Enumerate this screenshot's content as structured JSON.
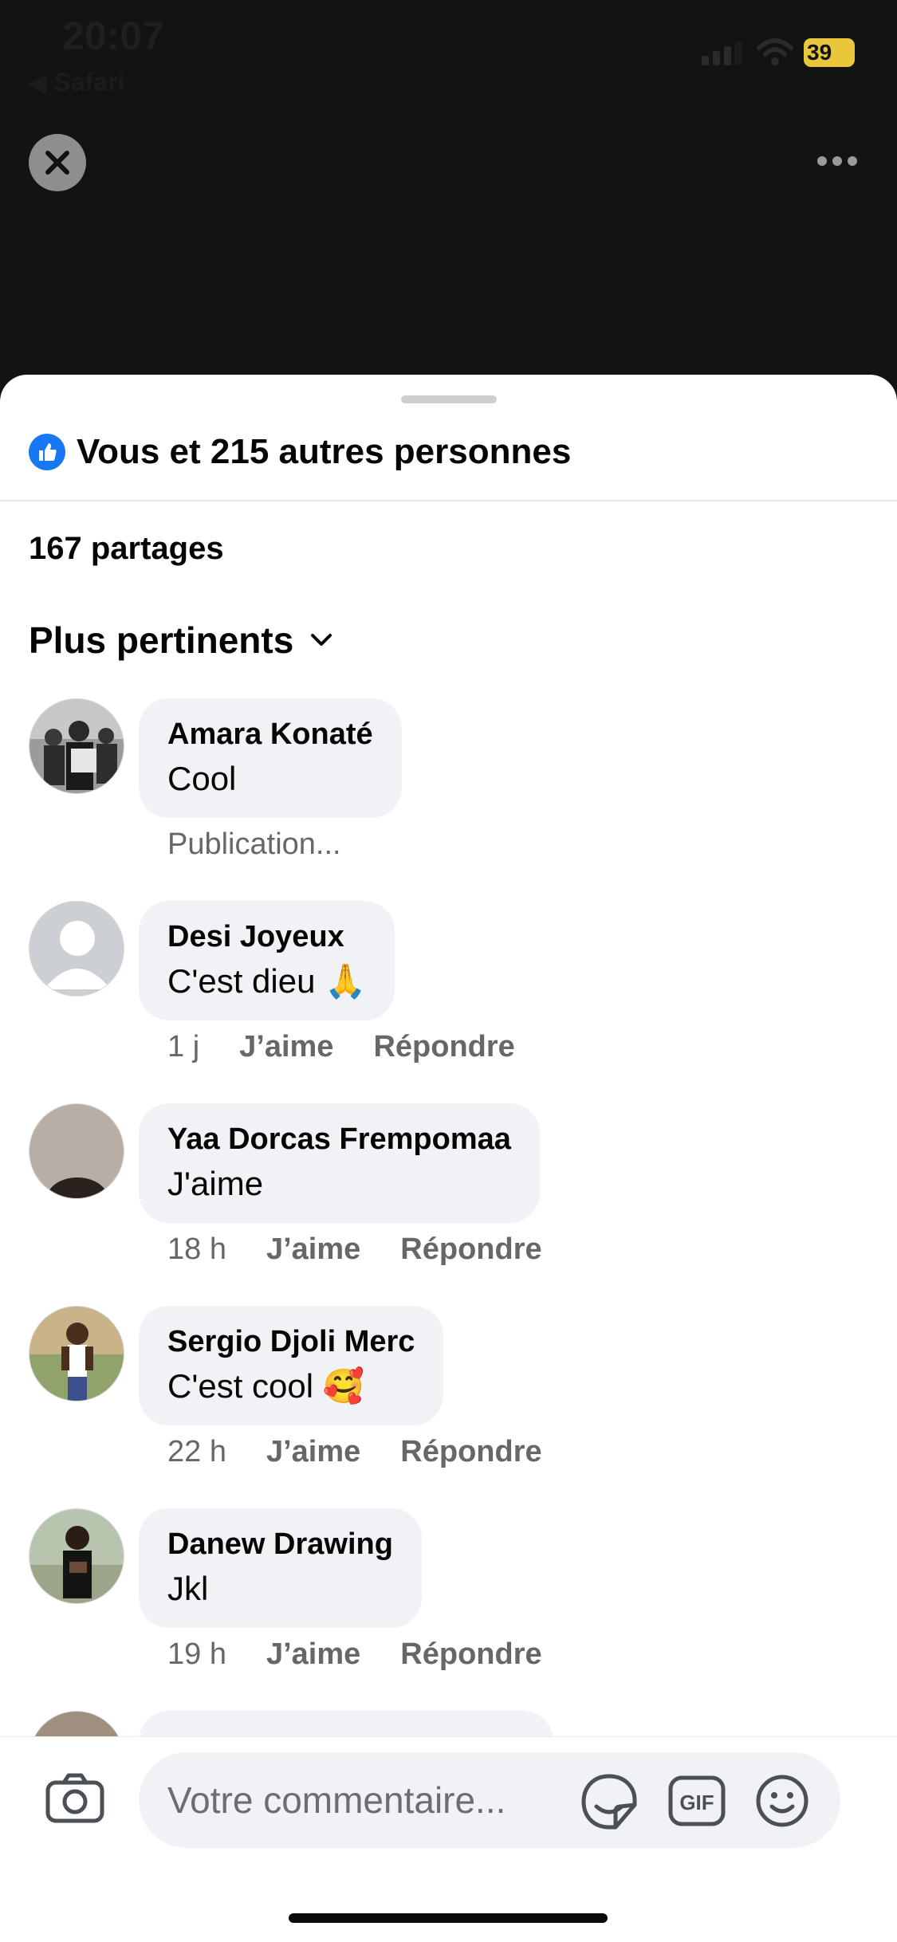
{
  "status_bar": {
    "time": "20:07",
    "back_app": "◀ Safari",
    "battery": "39"
  },
  "sheet": {
    "reactions_text": "Vous et 215 autres personnes",
    "shares_text": "167 partages",
    "sort_label": "Plus pertinents"
  },
  "comments": [
    {
      "author": "Amara Konaté",
      "text": "Cool",
      "status": "Publication..."
    },
    {
      "author": "Desi Joyeux",
      "text": "C'est dieu 🙏",
      "time": "1 j",
      "like": "J’aime",
      "reply": "Répondre"
    },
    {
      "author": "Yaa Dorcas Frempomaa",
      "text": "J'aime",
      "time": "18 h",
      "like": "J’aime",
      "reply": "Répondre"
    },
    {
      "author": "Sergio Djoli Merc",
      "text": "C'est cool 🥰",
      "time": "22 h",
      "like": "J’aime",
      "reply": "Répondre"
    },
    {
      "author": "Danew Drawing",
      "text": "Jkl",
      "time": "19 h",
      "like": "J’aime",
      "reply": "Répondre"
    }
  ],
  "composer": {
    "placeholder": "Votre commentaire...",
    "gif_label": "GIF"
  },
  "icons": {
    "close": "close-icon",
    "more": "more-horizontal-icon",
    "like": "thumbs-up-icon",
    "sort": "chevron-down-icon",
    "camera": "camera-icon",
    "sticker": "sticker-icon",
    "gif": "gif-icon",
    "emoji": "emoji-icon"
  },
  "colors": {
    "accent": "#1877f2",
    "bubble": "#f0f2f5",
    "meta_text": "#65676b",
    "backdrop": "#131313"
  }
}
